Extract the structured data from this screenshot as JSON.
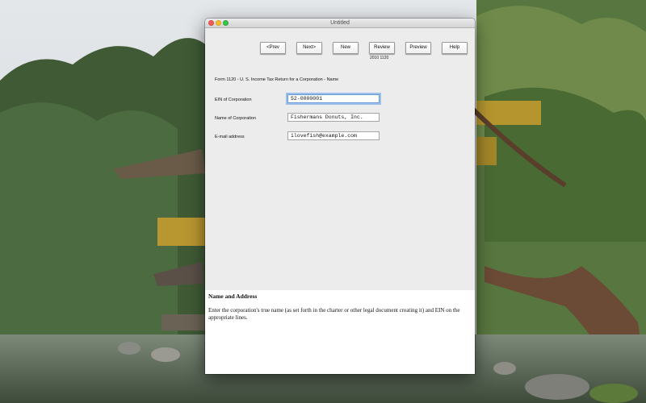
{
  "window": {
    "title": "Untitled"
  },
  "toolbar": {
    "prev_label": "<Prev",
    "next_label": "Next>",
    "new_label": "New",
    "review_label": "Review",
    "review_sublabel": "2010 1120",
    "preview_label": "Preview",
    "help_label": "Help"
  },
  "form": {
    "title": "Form 1120 - U. S. Income Tax Return for a Corporation - Name",
    "fields": [
      {
        "label": "EIN of Corporation",
        "value": "52-0000001"
      },
      {
        "label": "Name of Corporation",
        "value": "Fishermans Donuts, Inc."
      },
      {
        "label": "E-mail address",
        "value": "ilovefish@example.com"
      }
    ]
  },
  "help": {
    "title": "Name and Address",
    "text": "Enter the corporation's true name (as set forth in the charter or other legal document creating it) and EIN on the appropriate lines."
  }
}
